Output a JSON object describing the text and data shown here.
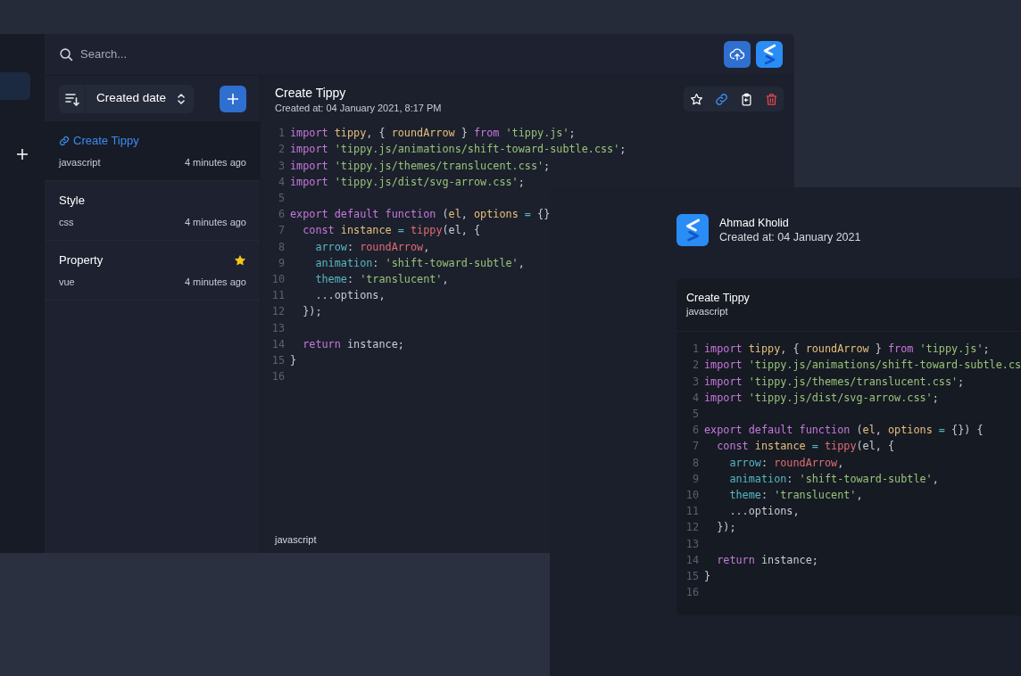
{
  "rail": {
    "items": [
      {
        "kind": "blank",
        "selected": true
      },
      {
        "kind": "add",
        "selected": false
      }
    ]
  },
  "search": {
    "placeholder": "Search..."
  },
  "sort": {
    "label": "Created date"
  },
  "snippets": [
    {
      "title": "Create Tippy",
      "language": "javascript",
      "time": "4 minutes ago",
      "selected": true,
      "shared": true,
      "starred": false
    },
    {
      "title": "Style",
      "language": "css",
      "time": "4 minutes ago",
      "selected": false,
      "shared": false,
      "starred": false
    },
    {
      "title": "Property",
      "language": "vue",
      "time": "4 minutes ago",
      "selected": false,
      "shared": false,
      "starred": true
    }
  ],
  "editor": {
    "title": "Create Tippy",
    "created": "Created at: 04 January 2021, 8:17 PM",
    "language": "javascript",
    "code": [
      {
        "n": "1",
        "tokens": [
          {
            "kind": "kw",
            "text": "import "
          },
          {
            "kind": "var",
            "text": "tippy"
          },
          {
            "kind": "p",
            "text": ", { "
          },
          {
            "kind": "var",
            "text": "roundArrow"
          },
          {
            "kind": "p",
            "text": " } "
          },
          {
            "kind": "kw",
            "text": "from "
          },
          {
            "kind": "str",
            "text": "'tippy.js'"
          },
          {
            "kind": "p",
            "text": ";"
          }
        ]
      },
      {
        "n": "2",
        "tokens": [
          {
            "kind": "kw",
            "text": "import "
          },
          {
            "kind": "str",
            "text": "'tippy.js/animations/shift-toward-subtle.css'"
          },
          {
            "kind": "p",
            "text": ";"
          }
        ]
      },
      {
        "n": "3",
        "tokens": [
          {
            "kind": "kw",
            "text": "import "
          },
          {
            "kind": "str",
            "text": "'tippy.js/themes/translucent.css'"
          },
          {
            "kind": "p",
            "text": ";"
          }
        ]
      },
      {
        "n": "4",
        "tokens": [
          {
            "kind": "kw",
            "text": "import "
          },
          {
            "kind": "str",
            "text": "'tippy.js/dist/svg-arrow.css'"
          },
          {
            "kind": "p",
            "text": ";"
          }
        ]
      },
      {
        "n": "5"
      },
      {
        "n": "6",
        "tokens": [
          {
            "kind": "kw",
            "text": "export default function "
          },
          {
            "kind": "p",
            "text": "("
          },
          {
            "kind": "var",
            "text": "el"
          },
          {
            "kind": "p",
            "text": ", "
          },
          {
            "kind": "var",
            "text": "options "
          },
          {
            "kind": "op",
            "text": "= "
          },
          {
            "kind": "p",
            "text": "{}"
          }
        ]
      },
      {
        "n": "7",
        "tokens": [
          {
            "kind": "kw",
            "text": "  const "
          },
          {
            "kind": "var",
            "text": "instance "
          },
          {
            "kind": "op",
            "text": "= "
          },
          {
            "kind": "fn",
            "text": "tippy"
          },
          {
            "kind": "p",
            "text": "(el, {"
          }
        ]
      },
      {
        "n": "8",
        "tokens": [
          {
            "kind": "prop",
            "text": "    arrow"
          },
          {
            "kind": "p",
            "text": ": "
          },
          {
            "kind": "fn",
            "text": "roundArrow"
          },
          {
            "kind": "p",
            "text": ","
          }
        ]
      },
      {
        "n": "9",
        "tokens": [
          {
            "kind": "prop",
            "text": "    animation"
          },
          {
            "kind": "p",
            "text": ": "
          },
          {
            "kind": "str",
            "text": "'shift-toward-subtle'"
          },
          {
            "kind": "p",
            "text": ","
          }
        ]
      },
      {
        "n": "10",
        "tokens": [
          {
            "kind": "prop",
            "text": "    theme"
          },
          {
            "kind": "p",
            "text": ": "
          },
          {
            "kind": "str",
            "text": "'translucent'"
          },
          {
            "kind": "p",
            "text": ","
          }
        ]
      },
      {
        "n": "11",
        "tokens": [
          {
            "kind": "p",
            "text": "    ...options,"
          }
        ]
      },
      {
        "n": "12",
        "tokens": [
          {
            "kind": "p",
            "text": "  });"
          }
        ]
      },
      {
        "n": "13"
      },
      {
        "n": "14",
        "tokens": [
          {
            "kind": "kw",
            "text": "  return "
          },
          {
            "kind": "p",
            "text": "instance;"
          }
        ]
      },
      {
        "n": "15",
        "tokens": [
          {
            "kind": "p",
            "text": "}"
          }
        ]
      },
      {
        "n": "16"
      }
    ]
  },
  "share": {
    "author": "Ahmad Kholid",
    "created": "Created at: 04 January 2021",
    "title": "Create Tippy",
    "language": "javascript",
    "code": [
      {
        "n": "1",
        "tokens": [
          {
            "kind": "kw",
            "text": "import "
          },
          {
            "kind": "var",
            "text": "tippy"
          },
          {
            "kind": "p",
            "text": ", { "
          },
          {
            "kind": "var",
            "text": "roundArrow"
          },
          {
            "kind": "p",
            "text": " } "
          },
          {
            "kind": "kw",
            "text": "from "
          },
          {
            "kind": "str",
            "text": "'tippy.js'"
          },
          {
            "kind": "p",
            "text": ";"
          }
        ]
      },
      {
        "n": "2",
        "tokens": [
          {
            "kind": "kw",
            "text": "import "
          },
          {
            "kind": "str",
            "text": "'tippy.js/animations/shift-toward-subtle.cs"
          }
        ]
      },
      {
        "n": "3",
        "tokens": [
          {
            "kind": "kw",
            "text": "import "
          },
          {
            "kind": "str",
            "text": "'tippy.js/themes/translucent.css'"
          },
          {
            "kind": "p",
            "text": ";"
          }
        ]
      },
      {
        "n": "4",
        "tokens": [
          {
            "kind": "kw",
            "text": "import "
          },
          {
            "kind": "str",
            "text": "'tippy.js/dist/svg-arrow.css'"
          },
          {
            "kind": "p",
            "text": ";"
          }
        ]
      },
      {
        "n": "5"
      },
      {
        "n": "6",
        "tokens": [
          {
            "kind": "kw",
            "text": "export default function "
          },
          {
            "kind": "p",
            "text": "("
          },
          {
            "kind": "var",
            "text": "el"
          },
          {
            "kind": "p",
            "text": ", "
          },
          {
            "kind": "var",
            "text": "options "
          },
          {
            "kind": "op",
            "text": "= "
          },
          {
            "kind": "p",
            "text": "{}) {"
          }
        ]
      },
      {
        "n": "7",
        "tokens": [
          {
            "kind": "kw",
            "text": "  const "
          },
          {
            "kind": "var",
            "text": "instance "
          },
          {
            "kind": "op",
            "text": "= "
          },
          {
            "kind": "fn",
            "text": "tippy"
          },
          {
            "kind": "p",
            "text": "(el, {"
          }
        ]
      },
      {
        "n": "8",
        "tokens": [
          {
            "kind": "prop",
            "text": "    arrow"
          },
          {
            "kind": "p",
            "text": ": "
          },
          {
            "kind": "fn",
            "text": "roundArrow"
          },
          {
            "kind": "p",
            "text": ","
          }
        ]
      },
      {
        "n": "9",
        "tokens": [
          {
            "kind": "prop",
            "text": "    animation"
          },
          {
            "kind": "p",
            "text": ": "
          },
          {
            "kind": "str",
            "text": "'shift-toward-subtle'"
          },
          {
            "kind": "p",
            "text": ","
          }
        ]
      },
      {
        "n": "10",
        "tokens": [
          {
            "kind": "prop",
            "text": "    theme"
          },
          {
            "kind": "p",
            "text": ": "
          },
          {
            "kind": "str",
            "text": "'translucent'"
          },
          {
            "kind": "p",
            "text": ","
          }
        ]
      },
      {
        "n": "11",
        "tokens": [
          {
            "kind": "p",
            "text": "    ...options,"
          }
        ]
      },
      {
        "n": "12",
        "tokens": [
          {
            "kind": "p",
            "text": "  });"
          }
        ]
      },
      {
        "n": "13"
      },
      {
        "n": "14",
        "tokens": [
          {
            "kind": "kw",
            "text": "  return "
          },
          {
            "kind": "p",
            "text": "instance;"
          }
        ]
      },
      {
        "n": "15",
        "tokens": [
          {
            "kind": "p",
            "text": "}"
          }
        ]
      },
      {
        "n": "16"
      }
    ]
  }
}
